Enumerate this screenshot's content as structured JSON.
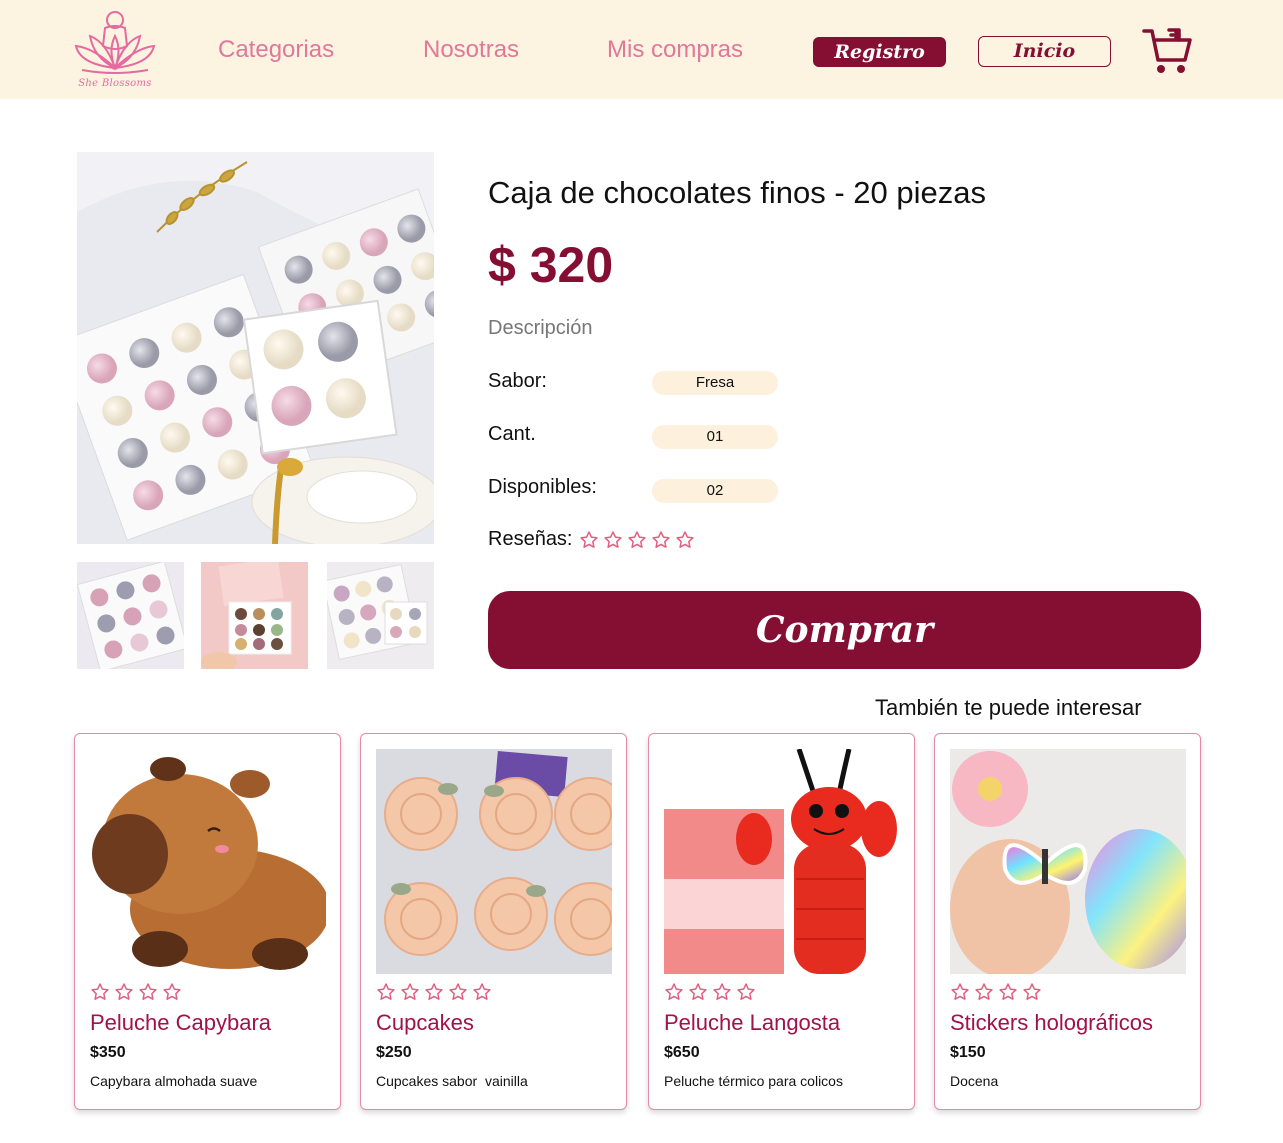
{
  "header": {
    "logo_text": "She Blossoms",
    "nav": [
      "Categorias",
      "Nosotras",
      "Mis compras"
    ],
    "register_label": "Registro",
    "login_label": "Inicio"
  },
  "product": {
    "title": "Caja de chocolates finos - 20 piezas",
    "price": "$ 320",
    "description_label": "Descripción",
    "flavor_label": "Sabor:",
    "flavor_value": "Fresa",
    "qty_label": "Cant.",
    "qty_value": "01",
    "available_label": "Disponibles:",
    "available_value": "02",
    "reviews_label": "Reseñas:",
    "buy_label": "Comprar"
  },
  "related": {
    "heading": "También te puede interesar",
    "items": [
      {
        "name": "Peluche Capybara",
        "price": "$350",
        "desc": "Capybara almohada suave"
      },
      {
        "name": "Cupcakes",
        "price": "$250",
        "desc": "Cupcakes sabor  vainilla"
      },
      {
        "name": "Peluche Langosta",
        "price": "$650",
        "desc": "Peluche térmico para colicos"
      },
      {
        "name": "Stickers holográficos",
        "price": "$150",
        "desc": "Docena"
      }
    ]
  },
  "colors": {
    "accent": "#840f33",
    "header_bg": "#fdf3e1",
    "pink": "#e0789a"
  }
}
